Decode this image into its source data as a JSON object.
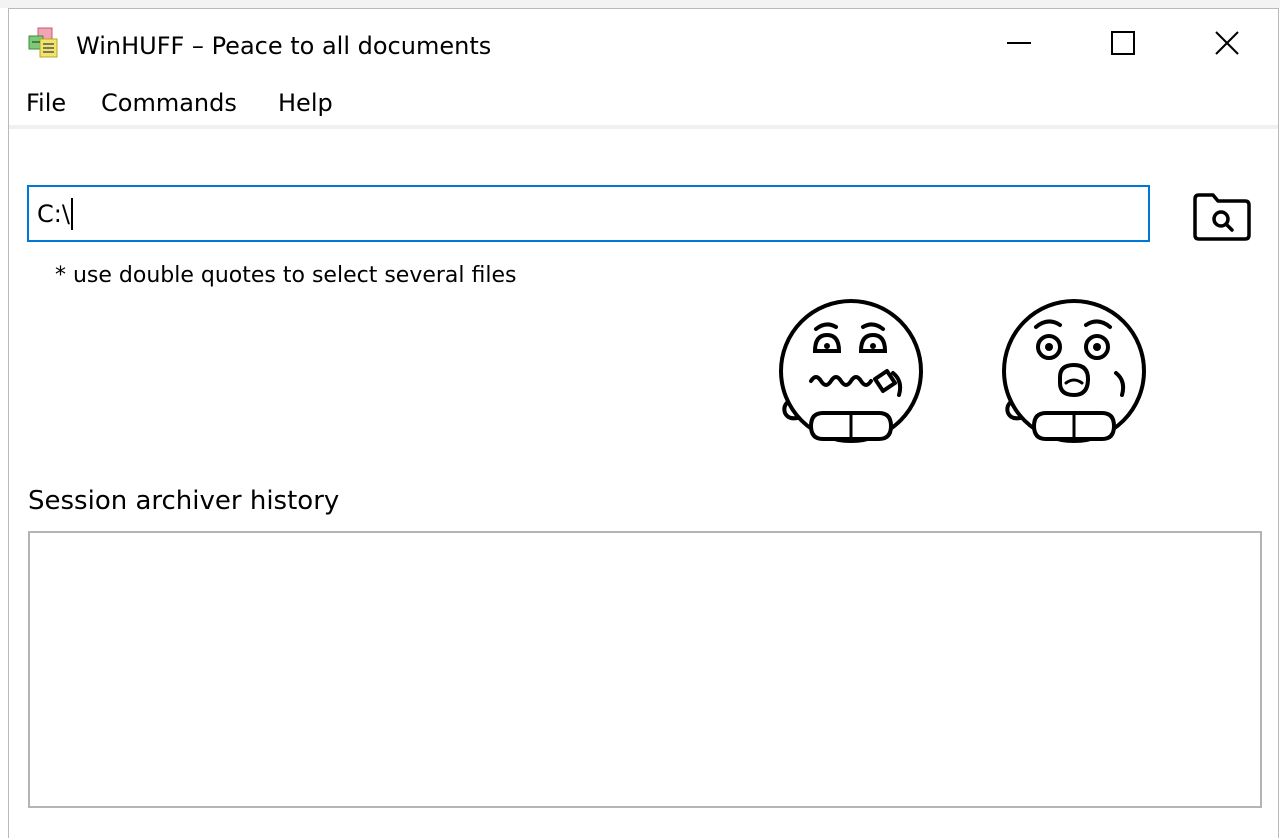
{
  "window": {
    "title": "WinHUFF – Peace to all documents",
    "app_icon": "stacked-documents-icon",
    "controls": [
      "minimize-icon",
      "maximize-icon",
      "close-icon"
    ]
  },
  "menu": {
    "items": [
      {
        "label": "File"
      },
      {
        "label": "Commands"
      },
      {
        "label": "Help"
      }
    ]
  },
  "path": {
    "value": "C:\\",
    "browse_icon": "folder-search-icon"
  },
  "hint": "* use double quotes to select several files",
  "mascots": {
    "left_icon": "zipped-mouth-face-icon",
    "right_icon": "surprised-face-icon"
  },
  "history": {
    "label": "Session archiver history",
    "items": []
  },
  "colors": {
    "input_focus_border": "#0078d7",
    "box_border": "#b4b4b4"
  }
}
